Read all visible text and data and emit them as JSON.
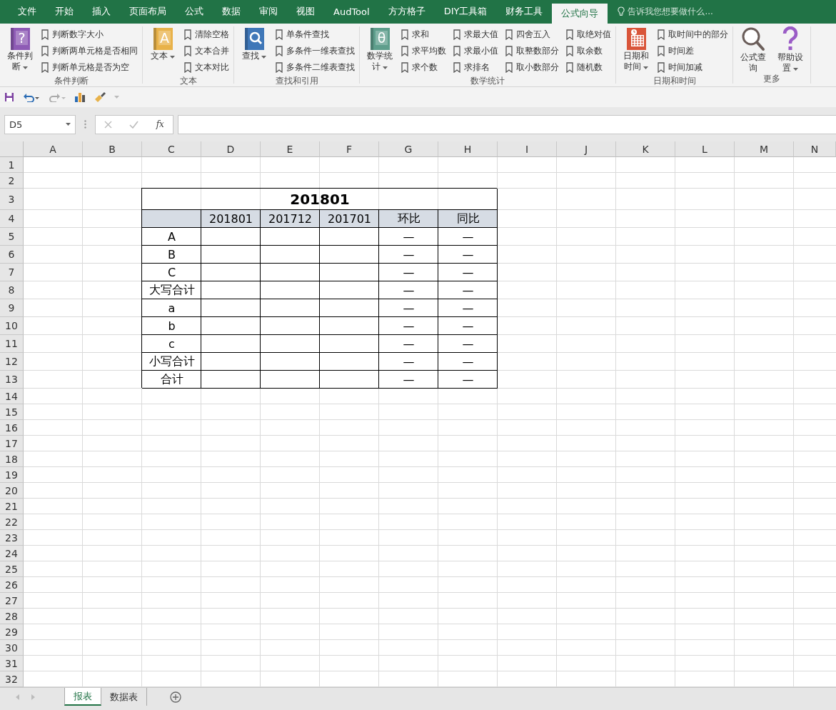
{
  "tabs": [
    {
      "label": "文件",
      "selected": false
    },
    {
      "label": "开始",
      "selected": false
    },
    {
      "label": "插入",
      "selected": false
    },
    {
      "label": "页面布局",
      "selected": false
    },
    {
      "label": "公式",
      "selected": false
    },
    {
      "label": "数据",
      "selected": false
    },
    {
      "label": "审阅",
      "selected": false
    },
    {
      "label": "视图",
      "selected": false
    },
    {
      "label": "AudTool",
      "selected": false
    },
    {
      "label": "方方格子",
      "selected": false
    },
    {
      "label": "DIY工具箱",
      "selected": false
    },
    {
      "label": "财务工具",
      "selected": false
    },
    {
      "label": "公式向导",
      "selected": true
    }
  ],
  "tell_me": {
    "placeholder": "告诉我您想要做什么..."
  },
  "ribbon_groups": [
    {
      "title": "条件判断",
      "large": [
        {
          "label": "条件判断",
          "kind": "purple-book",
          "glyph": "?",
          "menu": true
        }
      ],
      "small": [
        "判断数字大小",
        "判断两单元格是否相同",
        "判断单元格是否为空"
      ]
    },
    {
      "title": "文本",
      "large": [
        {
          "label": "文本",
          "kind": "yellow-book",
          "glyph": "A",
          "menu": true
        }
      ],
      "small": [
        "清除空格",
        "文本合并",
        "文本对比"
      ]
    },
    {
      "title": "查找和引用",
      "large": [
        {
          "label": "查找",
          "kind": "search-book",
          "menu": true
        }
      ],
      "small": [
        "单条件查找",
        "多条件一维表查找",
        "多条件二维表查找"
      ]
    },
    {
      "title": "数学统计",
      "large": [
        {
          "label": "数学统计",
          "kind": "teal-book",
          "glyph": "θ",
          "menu": true
        }
      ],
      "small": [
        "求和",
        "求平均数",
        "求个数",
        "求最大值",
        "求最小值",
        "求排名",
        "四舍五入",
        "取整数部分",
        "取小数部分",
        "取绝对值",
        "取余数",
        "随机数"
      ]
    },
    {
      "title": "日期和时间",
      "large": [
        {
          "label": "日期和时间",
          "kind": "calendar",
          "menu": true
        }
      ],
      "small": [
        "取时间中的部分",
        "时间差",
        "时间加减"
      ]
    },
    {
      "title": "更多",
      "large": [
        {
          "label": "公式查询",
          "kind": "magnifier",
          "menu": false
        },
        {
          "label": "帮助设置",
          "kind": "question",
          "menu": true
        }
      ]
    }
  ],
  "name_box": {
    "value": "D5"
  },
  "formula_bar": {
    "fx_label": "fx"
  },
  "columns": [
    "A",
    "B",
    "C",
    "D",
    "E",
    "F",
    "G",
    "H",
    "I",
    "J",
    "K",
    "L",
    "M",
    "N"
  ],
  "row_numbers": [
    "1",
    "2",
    "3",
    "4",
    "5",
    "6",
    "7",
    "8",
    "9",
    "10",
    "11",
    "12",
    "13",
    "14",
    "15",
    "16",
    "17",
    "18",
    "19",
    "20",
    "21",
    "22",
    "23",
    "24",
    "25",
    "26",
    "27",
    "28",
    "29",
    "30",
    "31",
    "32"
  ],
  "report": {
    "title": "201801",
    "header": [
      "201801",
      "201712",
      "201701",
      "环比",
      "同比"
    ],
    "rows": [
      {
        "label": "A",
        "mom": "—",
        "yoy": "—"
      },
      {
        "label": "B",
        "mom": "—",
        "yoy": "—"
      },
      {
        "label": "C",
        "mom": "—",
        "yoy": "—"
      },
      {
        "label": "大写合计",
        "mom": "—",
        "yoy": "—"
      },
      {
        "label": "a",
        "mom": "—",
        "yoy": "—"
      },
      {
        "label": "b",
        "mom": "—",
        "yoy": "—"
      },
      {
        "label": "c",
        "mom": "—",
        "yoy": "—"
      },
      {
        "label": "小写合计",
        "mom": "—",
        "yoy": "—"
      },
      {
        "label": "合计",
        "mom": "—",
        "yoy": "—"
      }
    ]
  },
  "sheet_tabs": [
    {
      "label": "报表",
      "selected": true
    },
    {
      "label": "数据表",
      "selected": false
    }
  ]
}
